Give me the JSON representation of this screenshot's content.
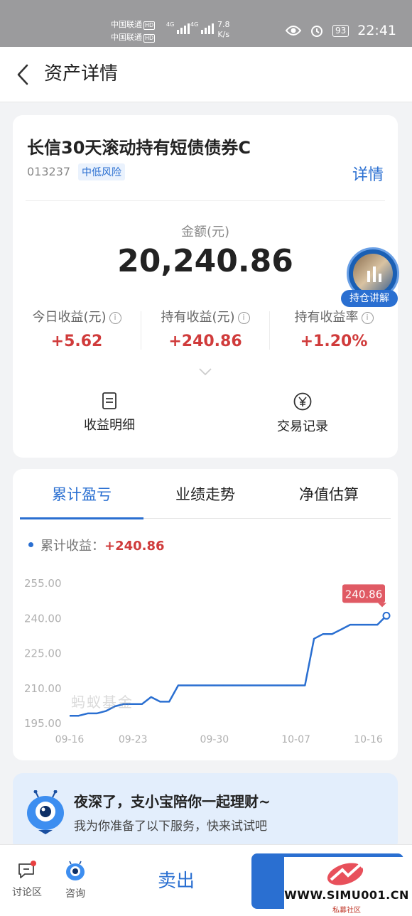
{
  "status_bar": {
    "carrier1": "中国联通",
    "carrier2": "中国联通",
    "hd": "HD",
    "net": "4G",
    "speed_value": "7.8",
    "speed_unit": "K/s",
    "battery": "93",
    "time": "22:41"
  },
  "header": {
    "title": "资产详情"
  },
  "fund": {
    "name": "长信30天滚动持有短债债券C",
    "code": "013237",
    "risk": "中低风险",
    "detail_label": "详情",
    "amount_label": "金额(元)",
    "amount": "20,240.86",
    "holding_badge": "持仓讲解",
    "metrics": [
      {
        "label": "今日收益(元)",
        "value": "+5.62"
      },
      {
        "label": "持有收益(元)",
        "value": "+240.86"
      },
      {
        "label": "持有收益率",
        "value": "+1.20%"
      }
    ],
    "info_glyph": "i",
    "actions": [
      {
        "label": "收益明细",
        "icon": "document-icon"
      },
      {
        "label": "交易记录",
        "icon": "yen-circle-icon"
      }
    ]
  },
  "chart_card": {
    "tabs": [
      "累计盈亏",
      "业绩走势",
      "净值估算"
    ],
    "active_tab": 0,
    "legend_label": "累计收益：",
    "legend_value": "+240.86",
    "watermark": "蚂蚁基金"
  },
  "chart_data": {
    "type": "line",
    "series": [
      {
        "name": "累计收益",
        "values": [
          198,
          198,
          199,
          199,
          200,
          202,
          203,
          203,
          203,
          206,
          204,
          204,
          211,
          211,
          211,
          211,
          211,
          211,
          211,
          211,
          211,
          211,
          211,
          211,
          211,
          211,
          211,
          231,
          233,
          233,
          235,
          237,
          237,
          237,
          237,
          240.86
        ]
      }
    ],
    "x_tick_labels": [
      "09-16",
      "09-23",
      "09-30",
      "10-07",
      "10-16"
    ],
    "x_tick_index": [
      0,
      7,
      16,
      25,
      33
    ],
    "y_ticks": [
      "195.00",
      "210.00",
      "225.00",
      "240.00",
      "255.00"
    ],
    "y_tick_values": [
      195,
      210,
      225,
      240,
      255
    ],
    "ylim": [
      195,
      255
    ],
    "last_label": "240.86",
    "grid": false,
    "colors": {
      "line": "#2a6fd1",
      "tooltip": "#e05a64"
    }
  },
  "promo": {
    "title": "夜深了，支小宝陪你一起理财~",
    "subtitle": "我为你准备了以下服务，快来试试吧"
  },
  "bottom_bar": {
    "discuss": "讨论区",
    "consult": "咨询",
    "sell": "卖出"
  },
  "watermark_site": {
    "url": "WWW.SIMU001.CN",
    "sub": "私募社区"
  }
}
